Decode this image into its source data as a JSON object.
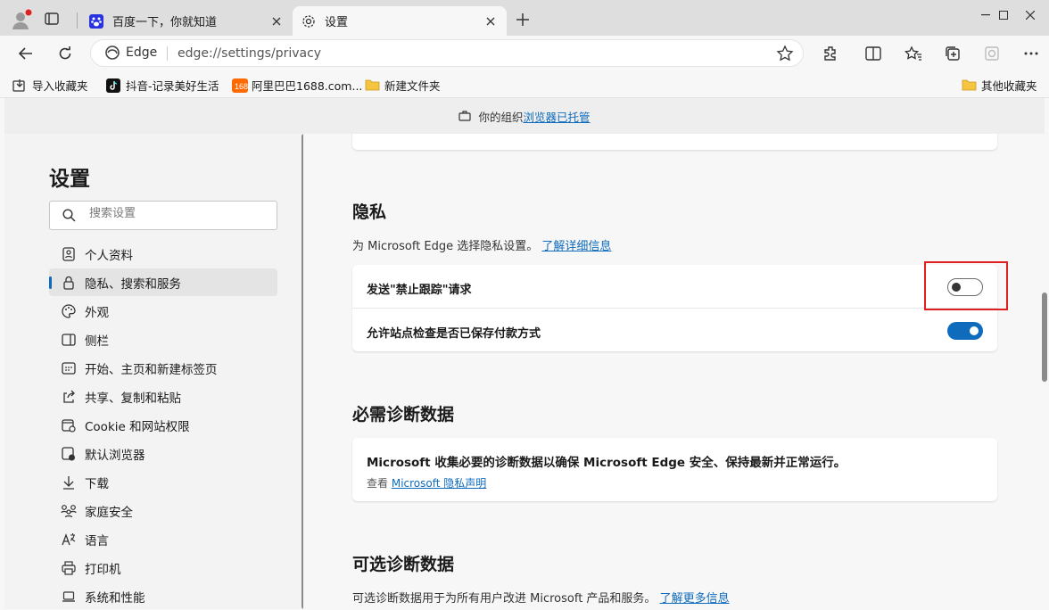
{
  "tabs": [
    {
      "title": "百度一下，你就知道",
      "icon": "baidu-paw-icon"
    },
    {
      "title": "设置",
      "icon": "gear-icon"
    }
  ],
  "address": {
    "badge": "Edge",
    "url": "edge://settings/privacy"
  },
  "favorites": {
    "items": [
      {
        "label": "导入收藏夹",
        "icon": "import-favorites-icon"
      },
      {
        "label": "抖音-记录美好生活",
        "icon": "douyin-icon"
      },
      {
        "label": "阿里巴巴1688.com...",
        "icon": "alibaba-icon"
      },
      {
        "label": "新建文件夹",
        "icon": "folder-icon"
      }
    ],
    "other": "其他收藏夹"
  },
  "managed": {
    "prefix": "你的组织",
    "link": "浏览器已托管"
  },
  "sidebar": {
    "title": "设置",
    "search_placeholder": "搜索设置",
    "items": [
      {
        "label": "个人资料",
        "icon": "profile-icon"
      },
      {
        "label": "隐私、搜索和服务",
        "icon": "lock-icon",
        "active": true
      },
      {
        "label": "外观",
        "icon": "palette-icon"
      },
      {
        "label": "侧栏",
        "icon": "sidebar-icon"
      },
      {
        "label": "开始、主页和新建标签页",
        "icon": "home-grid-icon"
      },
      {
        "label": "共享、复制和粘贴",
        "icon": "share-icon"
      },
      {
        "label": "Cookie 和网站权限",
        "icon": "cookie-icon"
      },
      {
        "label": "默认浏览器",
        "icon": "default-browser-icon"
      },
      {
        "label": "下载",
        "icon": "download-icon"
      },
      {
        "label": "家庭安全",
        "icon": "family-icon"
      },
      {
        "label": "语言",
        "icon": "language-icon"
      },
      {
        "label": "打印机",
        "icon": "printer-icon"
      },
      {
        "label": "系统和性能",
        "icon": "laptop-icon"
      }
    ]
  },
  "privacy": {
    "heading": "隐私",
    "desc": "为 Microsoft Edge 选择隐私设置。",
    "learn_more": "了解详细信息",
    "settings": [
      {
        "label": "发送\"禁止跟踪\"请求",
        "enabled": false
      },
      {
        "label": "允许站点检查是否已保存付款方式",
        "enabled": true
      }
    ]
  },
  "required_diag": {
    "heading": "必需诊断数据",
    "text": "Microsoft 收集必要的诊断数据以确保 Microsoft Edge 安全、保持最新并正常运行。",
    "see": "查看",
    "link": "Microsoft 隐私声明"
  },
  "optional_diag": {
    "heading": "可选诊断数据",
    "desc": "可选诊断数据用于为所有用户改进 Microsoft 产品和服务。",
    "link": "了解更多信息"
  },
  "colors": {
    "accent": "#0f6cbd",
    "highlight": "#e02020"
  }
}
